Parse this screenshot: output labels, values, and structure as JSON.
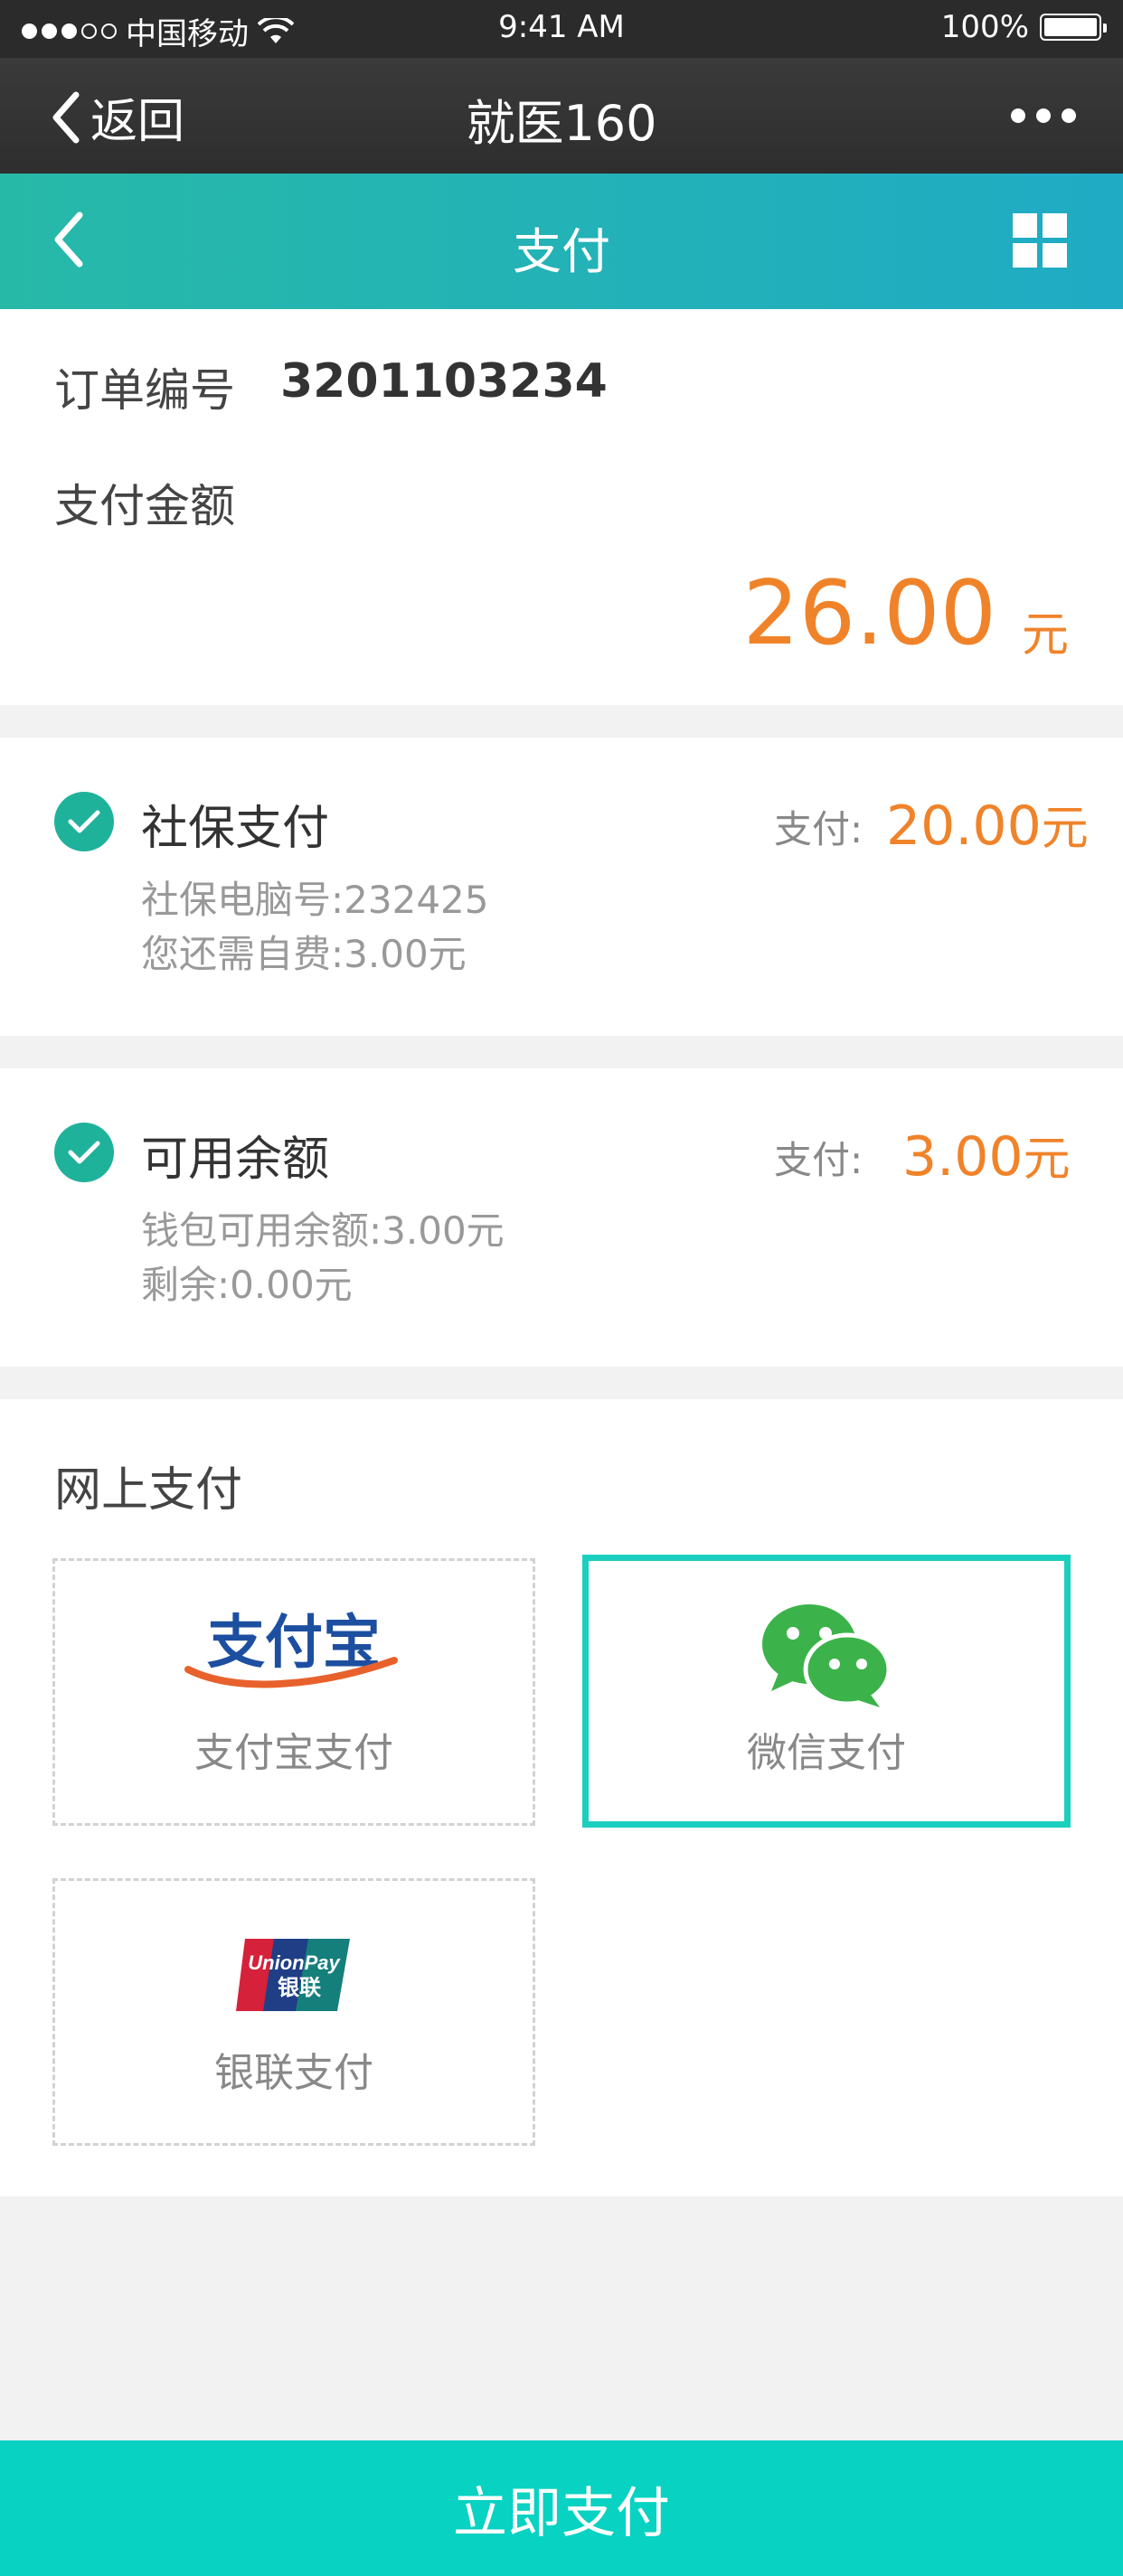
{
  "status_bar": {
    "carrier": "中国移动",
    "time": "9:41 AM",
    "battery": "100%"
  },
  "wechat_header": {
    "back_label": "返回",
    "title": "就医160"
  },
  "app_header": {
    "title": "支付"
  },
  "order": {
    "number_label": "订单编号",
    "number_value": "3201103234",
    "amount_label": "支付金额",
    "amount_value": "26.00",
    "amount_unit": "元"
  },
  "social_insurance": {
    "title": "社保支付",
    "pay_label": "支付:",
    "pay_value": "20.00",
    "pay_unit": "元",
    "line1": "社保电脑号:232425",
    "line2": "您还需自费:3.00元"
  },
  "balance": {
    "title": "可用余额",
    "pay_label": "支付:",
    "pay_value": "3.00",
    "pay_unit": "元",
    "line1": "钱包可用余额:3.00元",
    "line2": "剩余:0.00元"
  },
  "online": {
    "title": "网上支付",
    "methods": [
      {
        "label": "支付宝支付",
        "logo_text": "支付宝",
        "icon": "alipay-logo"
      },
      {
        "label": "微信支付",
        "icon": "wechat-logo",
        "selected": true
      },
      {
        "label": "银联支付",
        "logo_text_top": "UnionPay",
        "logo_text_bottom": "银联",
        "icon": "unionpay-logo"
      }
    ]
  },
  "pay_button": "立即支付",
  "colors": {
    "accent": "#08d2c2",
    "amount": "#f0832a",
    "check": "#1fb29b"
  }
}
